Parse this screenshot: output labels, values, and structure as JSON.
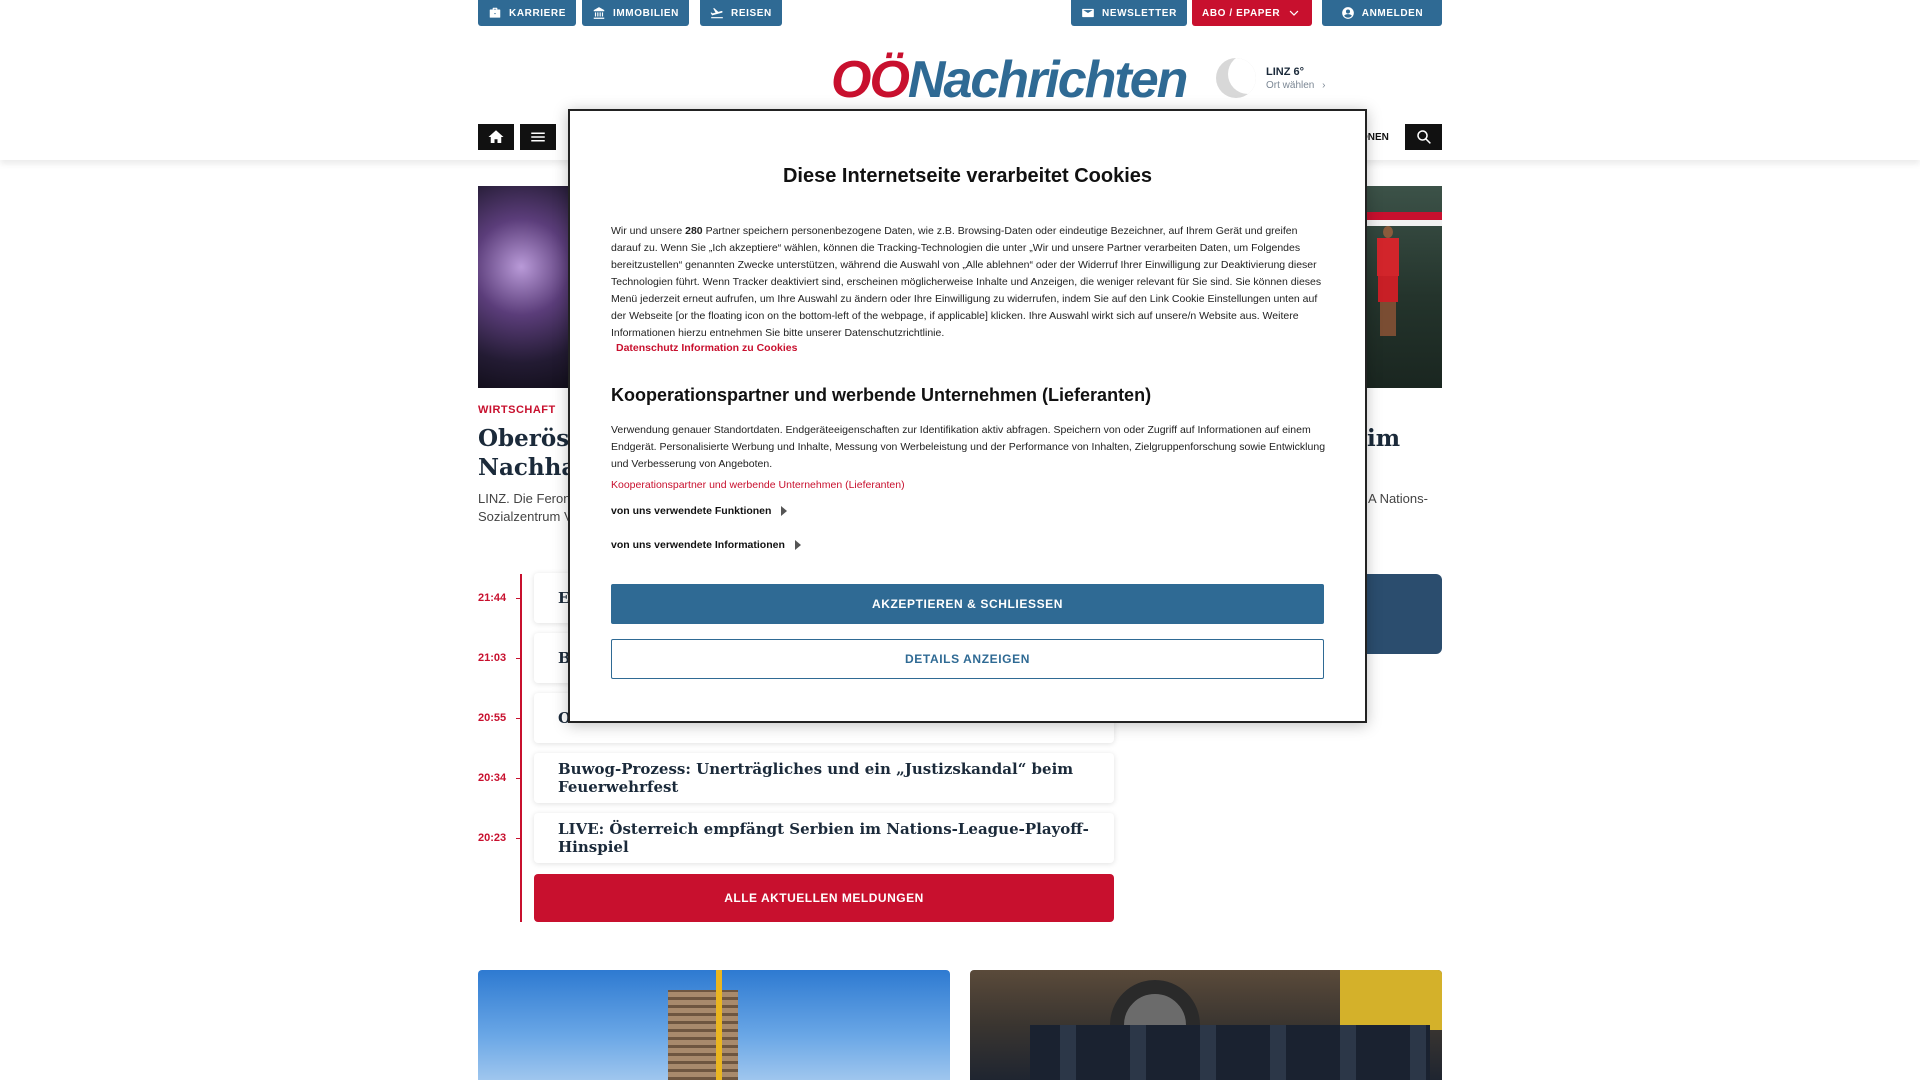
{
  "topbar": {
    "karriere": "KARRIERE",
    "immobilien": "IMMOBILIEN",
    "reisen": "REISEN",
    "newsletter": "NEWSLETTER",
    "abo": "ABO / EPAPER",
    "anmelden": "ANMELDEN"
  },
  "logo": {
    "part1": "OÖ",
    "part2": "Nachrichten"
  },
  "weather": {
    "city": "LINZ 6°",
    "choose": "Ort wählen"
  },
  "nav": {
    "partial_label": "ONEN"
  },
  "articles": {
    "left": {
      "category": "WIRTSCHAFT",
      "headline_line1": "Oberöst",
      "headline_line2": "Nachhal",
      "teaser_line1": "LINZ. Die Feron",
      "teaser_line2": "Sozialzentrum V"
    },
    "right": {
      "headline_suffix": "im",
      "teaser_suffix": "A Nations-"
    }
  },
  "ticker": {
    "items": [
      {
        "time": "21:44",
        "title": "E"
      },
      {
        "time": "21:03",
        "title": "B"
      },
      {
        "time": "20:55",
        "title": "O"
      },
      {
        "time": "20:34",
        "title": "Buwog-Prozess: Unerträgliches und ein „Justizskandal“ beim Feuerwehrfest"
      },
      {
        "time": "20:23",
        "title": "LIVE: Österreich empfängt Serbien im Nations-League-Playoff-Hinspiel"
      }
    ],
    "all_button": "ALLE AKTUELLEN MELDUNGEN"
  },
  "cookie": {
    "title": "Diese Internetseite verarbeitet Cookies",
    "partner_count": "280",
    "body_before": "Wir und unsere ",
    "body_after": " Partner speichern personenbezogene Daten, wie z.B. Browsing-Daten oder eindeutige Bezeichner, auf Ihrem Gerät und greifen darauf zu. Wenn Sie „Ich akzeptiere“ wählen, können die Tracking-Technologien die unter „Wir und unsere Partner verarbeiten Daten, um Folgendes bereitzustellen“ genannten Zwecke unterstützen, während die Auswahl von „Alle ablehnen“ oder der Widerruf Ihrer Einwilligung zur Deaktivierung dieser Technologien führt. Wenn Tracker deaktiviert sind, erscheinen möglicherweise Inhalte und Anzeigen, die weniger relevant für Sie sind. Sie können dieses Menü jederzeit erneut aufrufen, um Ihre Auswahl zu ändern oder Ihre Einwilligung zu widerrufen, indem Sie auf den Link Cookie Einstellungen unten auf der Webseite [or the floating icon on the bottom-left of the webpage, if applicable] klicken. Ihre Auswahl wirkt sich auf unsere/n Website aus. Weitere Informationen hierzu entnehmen Sie bitte unserer Datenschutzrichtlinie.",
    "privacy_link": "Datenschutz Information zu Cookies",
    "section_title": "Kooperationspartner und werbende Unternehmen (Lieferanten)",
    "section_body": "Verwendung genauer Standortdaten. Endgeräteeigenschaften zur Identifikation aktiv abfragen. Speichern von oder Zugriff auf Informationen auf einem Endgerät. Personalisierte Werbung und Inhalte, Messung von Werbeleistung und der Performance von Inhalten, Zielgruppenforschung sowie Entwicklung und Verbesserung von Angeboten.",
    "section_link": "Kooperationspartner und werbende Unternehmen (Lieferanten)",
    "expander1": "von uns verwendete Funktionen",
    "expander2": "von uns verwendete Informationen",
    "accept": "AKZEPTIEREN & SCHLIESSEN",
    "details": "DETAILS ANZEIGEN"
  },
  "colors": {
    "brand_red": "#c8102e",
    "brand_blue": "#2f6a94",
    "text_dark": "#1b2a3a"
  },
  "icons": [
    "briefcase-icon",
    "bank-icon",
    "plane-icon",
    "mail-icon",
    "chevron-down-icon",
    "user-icon",
    "moon-icon",
    "chevron-right-icon",
    "home-icon",
    "menu-icon",
    "search-icon",
    "triangle-right-icon"
  ]
}
